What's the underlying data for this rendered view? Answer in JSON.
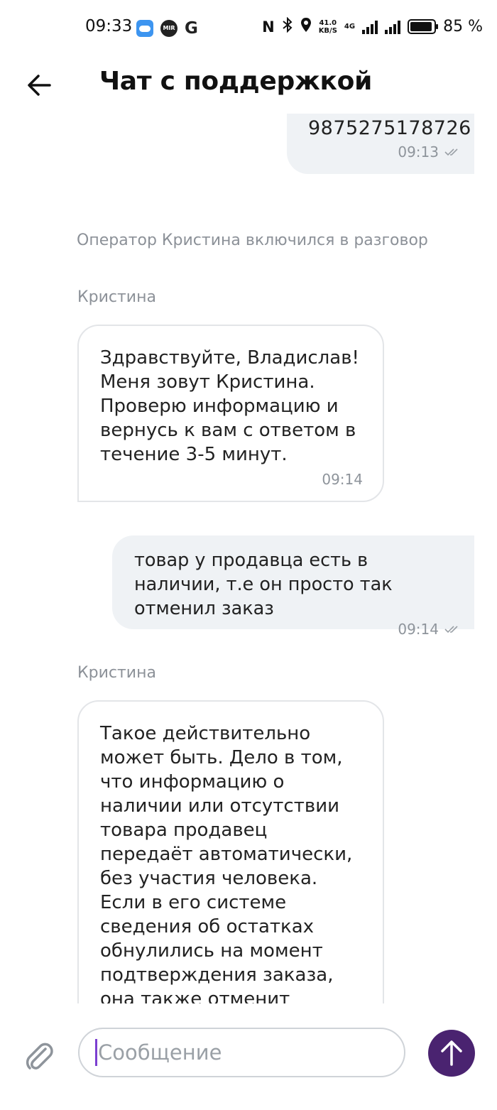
{
  "status_bar": {
    "time": "09:33",
    "mir_label": "MIR",
    "g_label": "G",
    "speed_value": "41.0",
    "speed_unit": "KB/S",
    "network": "4G",
    "battery": "85 %"
  },
  "header": {
    "title": "Чат с поддержкой",
    "back_icon": "arrow-left-icon"
  },
  "messages": [
    {
      "direction": "out",
      "text": "9875275178726",
      "time": "09:13",
      "status_icon": "double-check-icon"
    },
    {
      "type": "system",
      "text": "Оператор Кристина включился в разговор"
    },
    {
      "direction": "in",
      "sender": "Кристина",
      "text": "Здравствуйте, Владислав! Меня зовут Кристина. Проверю информацию и вернусь к вам с ответом в течение 3-5 минут.",
      "time": "09:14"
    },
    {
      "direction": "out",
      "text": "товар у продавца есть в наличии, т.е он просто так отменил заказ",
      "time": "09:14",
      "status_icon": "double-check-icon"
    },
    {
      "direction": "in",
      "sender": "Кристина",
      "text": "Такое действительно может быть. Дело в том, что информацию о наличии или отсутствии товара продавец передаёт автоматически, без участия человека. Если в его системе сведения об остатках обнулились на момент подтверждения заказа, она также отменит позицию в заказе. За это"
    }
  ],
  "composer": {
    "placeholder": "Сообщение",
    "attach_icon": "paperclip-icon",
    "send_icon": "arrow-up-icon"
  },
  "colors": {
    "accent": "#4a2370",
    "outgoing_bubble": "#eff2f5",
    "secondary_text": "#8e949b",
    "caret": "#7b3fd0"
  }
}
